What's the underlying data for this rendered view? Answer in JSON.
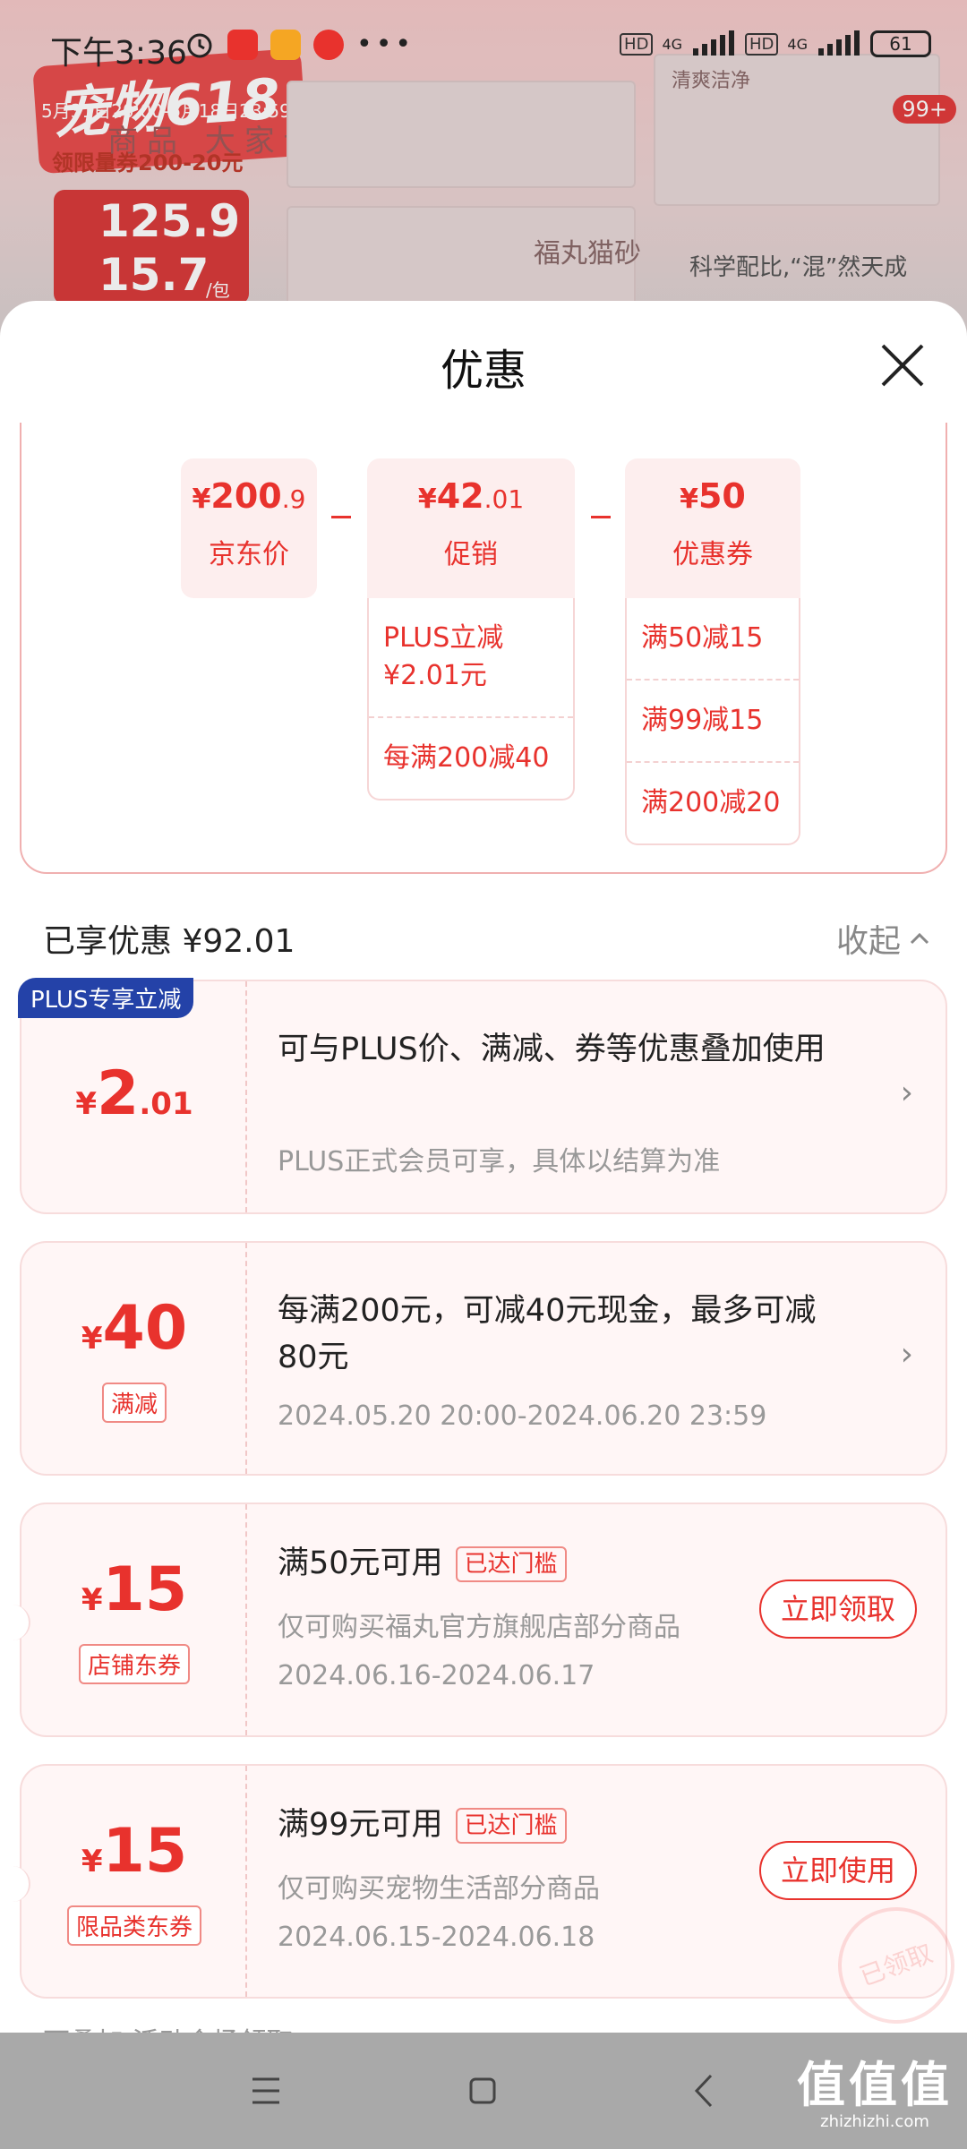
{
  "status_bar": {
    "time": "下午3:36",
    "network_1": "4G",
    "network_2": "4G",
    "hd_1": "HD",
    "hd_2": "HD",
    "battery": "61"
  },
  "background": {
    "promo_title": "宠物618",
    "promo_date": "5月31日20:00-6月18日23:59",
    "coupon_line": "领限量券200-20元",
    "price_1": "125.9",
    "price_2": "15.7",
    "price_unit": "/包",
    "tabs": "商品 大家评 详情 推荐",
    "brand_text": "福丸猫砂",
    "badge": "99+",
    "note": "科学配比,“混”然天成",
    "label_small": "清爽洁净"
  },
  "sheet": {
    "title": "优惠",
    "breakdown": [
      {
        "yen": "¥",
        "price_main": "200",
        "price_small": ".9",
        "label": "京东价",
        "items": []
      },
      {
        "yen": "¥",
        "price_main": "42",
        "price_small": ".01",
        "label": "促销",
        "items": [
          "PLUS立减 ¥2.01元",
          "每满200减40"
        ]
      },
      {
        "yen": "¥",
        "price_main": "50",
        "price_small": "",
        "label": "优惠券",
        "items": [
          "满50减15",
          "满99减15",
          "满200减20"
        ]
      }
    ],
    "enjoyed_label": "已享优惠 ¥92.01",
    "collapse_label": "收起",
    "cards": [
      {
        "badge": "PLUS专享立减",
        "yen": "¥",
        "amount": "2",
        "amount_small": ".01",
        "tag": "",
        "title": "可与PLUS价、满减、券等优惠叠加使用",
        "subtitle": "PLUS正式会员可享，具体以结算为准",
        "action": "arrow"
      },
      {
        "badge": "",
        "yen": "¥",
        "amount": "40",
        "amount_small": "",
        "tag": "满减",
        "title": "每满200元，可减40元现金，最多可减80元",
        "subtitle": "2024.05.20 20:00-2024.06.20 23:59",
        "action": "arrow"
      },
      {
        "badge": "",
        "yen": "¥",
        "amount": "15",
        "amount_small": "",
        "tag": "店铺东券",
        "title": "满50元可用",
        "threshold": "已达门槛",
        "subtitle": "仅可购买福丸官方旗舰店部分商品",
        "date": "2024.06.16-2024.06.17",
        "action_label": "立即领取"
      },
      {
        "badge": "",
        "yen": "¥",
        "amount": "15",
        "amount_small": "",
        "tag": "限品类东券",
        "title": "满99元可用",
        "threshold": "已达门槛",
        "subtitle": "仅可购买宠物生活部分商品",
        "date": "2024.06.15-2024.06.18",
        "action_label": "立即使用",
        "stamp": "已领取"
      }
    ],
    "more_text": "可叠加 活动会场领取"
  },
  "nav_bar": {
    "watermark": "值值值",
    "watermark_sub": "zhizhizhi.com"
  },
  "colors": {
    "accent": "#e8322d",
    "plus_badge": "#2442a8",
    "card_bg": "#fff6f6",
    "nav_bg": "#a9a9a9"
  }
}
